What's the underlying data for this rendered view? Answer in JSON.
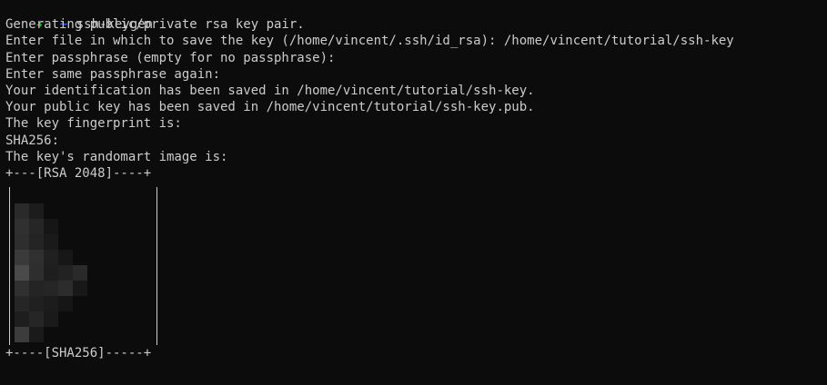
{
  "terminal": {
    "prompt": {
      "arrow": "➜",
      "dir": "~",
      "command": "ssh-keygen"
    },
    "output": [
      "Generating public/private rsa key pair.",
      "Enter file in which to save the key (/home/vincent/.ssh/id_rsa): /home/vincent/tutorial/ssh-key",
      "Enter passphrase (empty for no passphrase):",
      "Enter same passphrase again:",
      "Your identification has been saved in /home/vincent/tutorial/ssh-key.",
      "Your public key has been saved in /home/vincent/tutorial/ssh-key.pub.",
      "The key fingerprint is:",
      "SHA256:",
      "The key's randomart image is:"
    ],
    "art_top": "+---[RSA 2048]----+",
    "art_bottom": "+----[SHA256]-----+",
    "final_prompt": {
      "arrow": "➜",
      "dir": "~"
    }
  },
  "colors": {
    "background": "#0c0c0c",
    "text": "#cccccc",
    "prompt_arrow": "#16c60c",
    "prompt_dir": "#3b78ff"
  },
  "icons": {
    "prompt": "arrow-right-icon"
  }
}
